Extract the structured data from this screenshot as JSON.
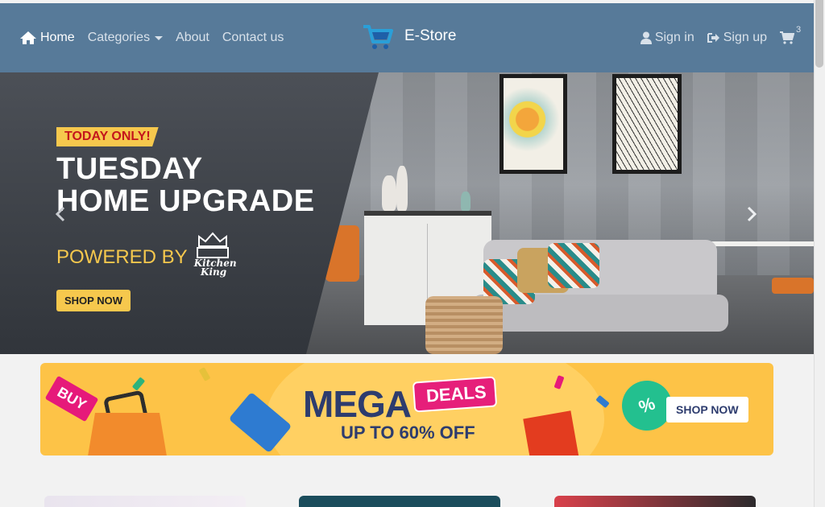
{
  "nav": {
    "home": "Home",
    "categories": "Categories",
    "about": "About",
    "contact": "Contact us",
    "brand": "E-Store",
    "sign_in": "Sign in",
    "sign_up": "Sign up",
    "cart_count": "3"
  },
  "hero": {
    "badge": "TODAY ONLY!",
    "headline_line1": "TUESDAY",
    "headline_line2": "HOME UPGRADE",
    "powered_by": "POWERED BY",
    "brand_logo_text": "Kitchen King",
    "cta": "SHOP NOW"
  },
  "promo": {
    "buy": "BUY",
    "mega": "MEGA",
    "deals": "DEALS",
    "subtitle": "UP TO 60% OFF",
    "cta": "SHOP NOW",
    "percent_badge": "%"
  },
  "colors": {
    "navbar": "#577a99",
    "accent_yellow": "#f6c84d",
    "promo_bg": "#fdc347",
    "deals_pink": "#e61f7a",
    "brand_blue": "#2d3c6e"
  },
  "icons": [
    "home-icon",
    "cart-logo-icon",
    "user-icon",
    "sign-up-icon",
    "cart-icon",
    "chevron-left-icon",
    "chevron-right-icon"
  ]
}
